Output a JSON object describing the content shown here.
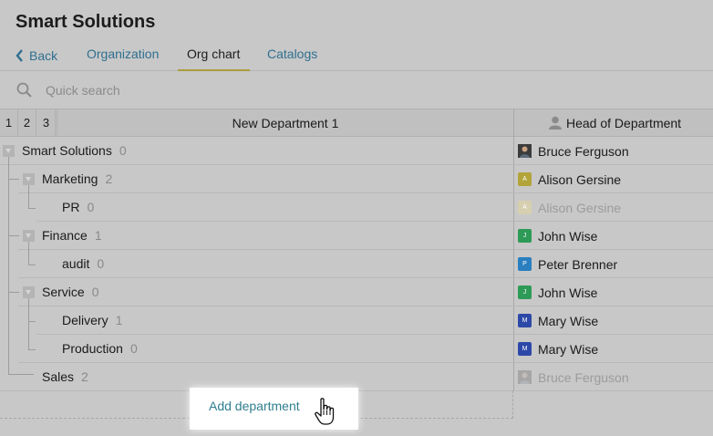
{
  "app": {
    "title": "Smart Solutions"
  },
  "nav": {
    "back_label": "Back",
    "tabs": [
      {
        "label": "Organization",
        "active": false
      },
      {
        "label": "Org chart",
        "active": true
      },
      {
        "label": "Catalogs",
        "active": false
      }
    ]
  },
  "search": {
    "placeholder": "Quick search",
    "value": ""
  },
  "table": {
    "levels": [
      "1",
      "2",
      "3"
    ],
    "dept_column": "New Department 1",
    "head_column": "Head of Department",
    "rows": [
      {
        "name": "Smart Solutions",
        "count": "0",
        "head": "Bruce Ferguson",
        "head_dim": false,
        "avatar": "photo",
        "avatar_color": "#3a3a3a"
      },
      {
        "name": "Marketing",
        "count": "2",
        "head": "Alison Gersine",
        "head_dim": false,
        "avatar": "A",
        "avatar_color": "#b3a43a"
      },
      {
        "name": "PR",
        "count": "0",
        "head": "Alison Gersine",
        "head_dim": true,
        "avatar": "A",
        "avatar_color": "#d6cfb0"
      },
      {
        "name": "Finance",
        "count": "1",
        "head": "John Wise",
        "head_dim": false,
        "avatar": "J",
        "avatar_color": "#2e9a57"
      },
      {
        "name": "audit",
        "count": "0",
        "head": "Peter Brenner",
        "head_dim": false,
        "avatar": "P",
        "avatar_color": "#2a7fc0"
      },
      {
        "name": "Service",
        "count": "0",
        "head": "John Wise",
        "head_dim": false,
        "avatar": "J",
        "avatar_color": "#2e9a57"
      },
      {
        "name": "Delivery",
        "count": "1",
        "head": "Mary Wise",
        "head_dim": false,
        "avatar": "M",
        "avatar_color": "#2d49a8"
      },
      {
        "name": "Production",
        "count": "0",
        "head": "Mary Wise",
        "head_dim": false,
        "avatar": "M",
        "avatar_color": "#2d49a8"
      },
      {
        "name": "Sales",
        "count": "2",
        "head": "Bruce Ferguson",
        "head_dim": true,
        "avatar": "photo",
        "avatar_color": "#a8a8a8"
      }
    ]
  },
  "actions": {
    "add_department": "Add department"
  }
}
